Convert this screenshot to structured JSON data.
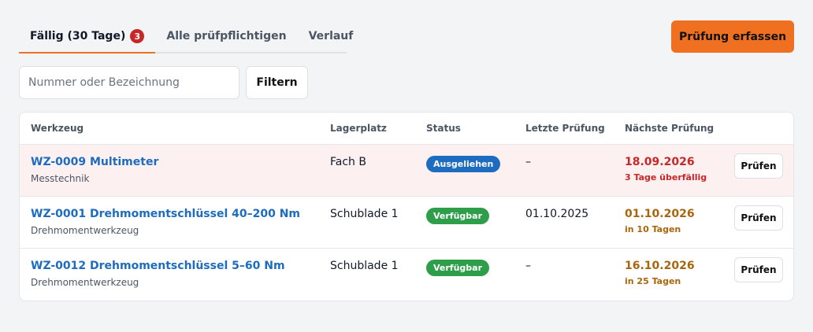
{
  "tabs": [
    {
      "label": "Fällig (30 Tage)",
      "badge": "3",
      "active": true
    },
    {
      "label": "Alle prüfpflichtigen",
      "active": false
    },
    {
      "label": "Verlauf",
      "active": false
    }
  ],
  "actions": {
    "primary_label": "Prüfung erfassen"
  },
  "search": {
    "placeholder": "Nummer oder Bezeichnung",
    "value": "",
    "filter_label": "Filtern"
  },
  "table": {
    "columns": [
      "Werkzeug",
      "Lagerplatz",
      "Status",
      "Letzte Prüfung",
      "Nächste Prüfung"
    ],
    "rows": [
      {
        "tool": "WZ-0009 Multimeter",
        "category": "Messtechnik",
        "location": "Fach B",
        "status": "Ausgeliehen",
        "last_check": "–",
        "next_check": "18.09.2026",
        "due_note": "3 Tage überfällig",
        "action": "Prüfen"
      },
      {
        "tool": "WZ-0001 Drehmomentschlüssel 40–200 Nm",
        "category": "Drehmomentwerkzeug",
        "location": "Schublade 1",
        "status": "Verfügbar",
        "last_check": "01.10.2025",
        "next_check": "01.10.2026",
        "due_note": "in 10 Tagen",
        "action": "Prüfen"
      },
      {
        "tool": "WZ-0012 Drehmomentschlüssel 5–60 Nm",
        "category": "Drehmomentwerkzeug",
        "location": "Schublade 1",
        "status": "Verfügbar",
        "last_check": "–",
        "next_check": "16.10.2026",
        "due_note": "in 25 Tagen",
        "action": "Prüfen"
      }
    ]
  },
  "colors": {
    "accent": "#f07021",
    "badge": "#c62828",
    "link": "#1d6cbf",
    "status_loaned": "#1d6cbf",
    "status_available": "#2e9e4a",
    "overdue_text": "#c62828",
    "upcoming_text": "#a8660c",
    "overdue_row_bg": "#fdf0f0"
  }
}
